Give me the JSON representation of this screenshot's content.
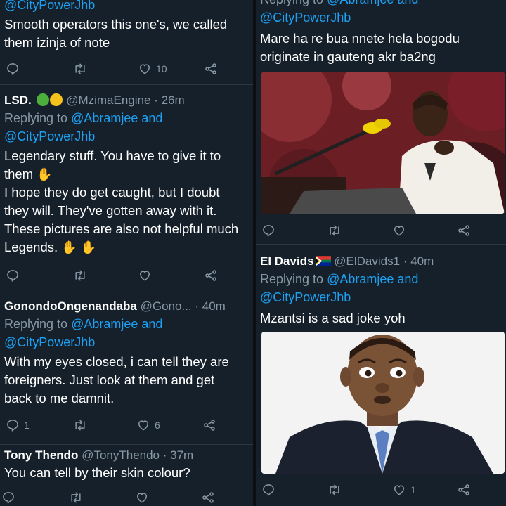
{
  "colors": {
    "bg": "#15202b",
    "link": "#1da1f2",
    "muted": "#8899a6",
    "text": "#ffffff"
  },
  "left": {
    "t1": {
      "reply_handle": "@CityPowerJhb",
      "body": "Smooth operators this one's, we called\nthem izinja of note",
      "like_count": "10"
    },
    "t2": {
      "name": "LSD.",
      "handle": "@MzimaEngine",
      "time": "· 26m",
      "reply_prefix": "Replying to",
      "reply_to1": "@Abramjee",
      "reply_and": "and",
      "reply_to2": "@CityPowerJhb",
      "line1": "Legendary stuff. You have to give it to",
      "line2": "them",
      "line3": "I hope they do get caught, but I doubt",
      "line4": "they will. They've gotten away with it.",
      "line5": "These pictures are also not helpful much",
      "line6": "Legends."
    },
    "t3": {
      "name": "GonondoOngenandaba",
      "handle": "@Gono...",
      "time": "· 40m",
      "reply_prefix": "Replying to",
      "reply_to1": "@Abramjee",
      "reply_and": "and",
      "reply_to2": "@CityPowerJhb",
      "body": "With my eyes closed, i can tell they are\nforeigners. Just look at them and get\nback to me damnit.",
      "reply_count": "1",
      "like_count": "6"
    },
    "t4": {
      "name": "Tony Thendo",
      "handle": "@TonyThendo",
      "time": "· 37m",
      "body": "You can tell by their skin colour?"
    }
  },
  "right": {
    "t1": {
      "reply_prefix": "Replying to",
      "reply_to1": "@Abramjee",
      "reply_and": "and",
      "reply_to2": "@CityPowerJhb",
      "body": "Mare ha re bua nnete hela bogodu\noriginate in gauteng akr ba2ng"
    },
    "t2": {
      "name": "El Davids",
      "handle": "@ElDavids1",
      "time": "· 40m",
      "reply_prefix": "Replying to",
      "reply_to1": "@Abramjee",
      "reply_and": "and",
      "reply_to2": "@CityPowerJhb",
      "body": "Mzantsi is a sad joke yoh",
      "like_count": "1"
    }
  },
  "icons": [
    "reply-icon",
    "retweet-icon",
    "like-icon",
    "share-icon",
    "waving-hand-icon",
    "south-africa-flag-icon",
    "green-circle-icon",
    "yellow-circle-icon"
  ]
}
